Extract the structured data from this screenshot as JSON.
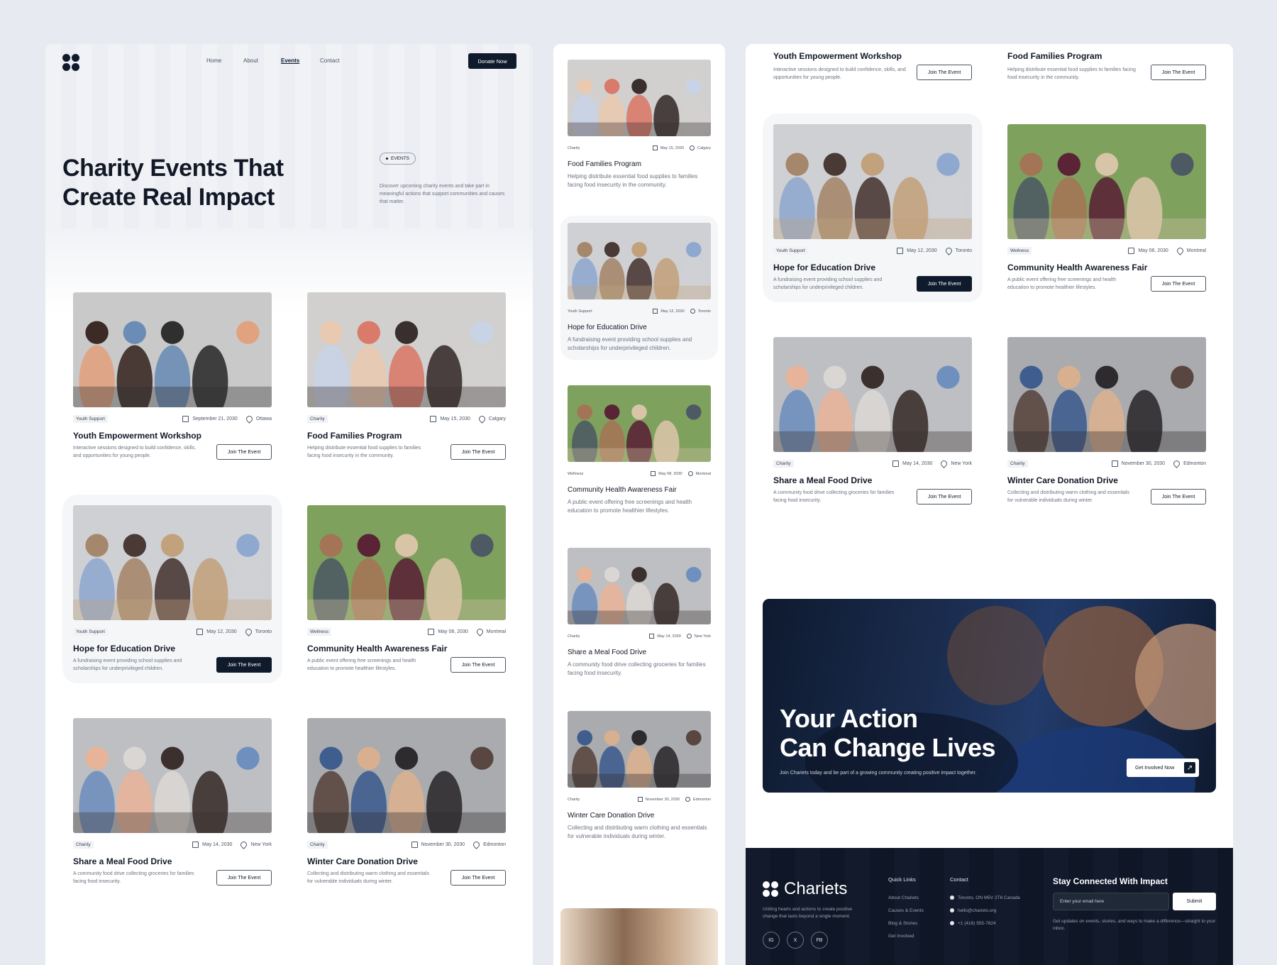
{
  "colors": {
    "navy": "#0f1b2d",
    "bg": "#e7eaf0",
    "text": "#121826",
    "muted": "#6b7280"
  },
  "icons": {
    "logo": "clover-logo-icon",
    "date": "calendar-icon",
    "location": "location-pin-icon",
    "arrow": "arrow-up-right-icon"
  },
  "nav": {
    "items": [
      "Home",
      "About",
      "Events",
      "Contact"
    ],
    "active": "Events",
    "donate": "Donate Now"
  },
  "hero": {
    "title_line1": "Charity Events That",
    "title_line2": "Create Real Impact",
    "badge": "EVENTS",
    "desc": "Discover upcoming charity events and take part in meaningful actions that support communities and causes that matter."
  },
  "events": [
    {
      "tag": "Youth Support",
      "date": "September 21, 2030",
      "location": "Ottawa",
      "title": "Youth Empowerment Workshop",
      "desc": "Interactive sessions designed to build confidence, skills, and opportunities for young people.",
      "button": "Join The Event"
    },
    {
      "tag": "Charity",
      "date": "May 15, 2030",
      "location": "Calgary",
      "title": "Food Families Program",
      "desc": "Helping distribute essential food supplies to families facing food insecurity in the community.",
      "button": "Join The Event"
    },
    {
      "tag": "Youth Support",
      "date": "May 12, 2030",
      "location": "Toronto",
      "title": "Hope for Education Drive",
      "desc": "A fundraising event providing school supplies and scholarships for underprivileged children.",
      "button": "Join The Event"
    },
    {
      "tag": "Wellness",
      "date": "May 08, 2030",
      "location": "Montreal",
      "title": "Community Health Awareness Fair",
      "desc": "A public event offering free screenings and health education to promote healthier lifestyles.",
      "button": "Join The Event"
    },
    {
      "tag": "Charity",
      "date": "May 14, 2030",
      "location": "New York",
      "title": "Share a Meal Food Drive",
      "desc": "A community food drive collecting groceries for families facing food insecurity.",
      "button": "Join The Event"
    },
    {
      "tag": "Charity",
      "date": "November 30, 2030",
      "location": "Edmonton",
      "title": "Winter Care Donation Drive",
      "desc": "Collecting and distributing warm clothing and essentials for vulnerable individuals during winter.",
      "button": "Join The Event"
    }
  ],
  "cta": {
    "line1": "Your Action",
    "line2": "Can Change Lives",
    "sub": "Join Chariets today and be part of a growing community creating positive impact together.",
    "button": "Get Involved Now"
  },
  "footer": {
    "brand": "Chariets",
    "tagline": "Uniting hearts and actions to create positive change that lasts beyond a single moment.",
    "social": [
      "IG",
      "X",
      "FB"
    ],
    "quick_title": "Quick Links",
    "quick": [
      "About Chariets",
      "Causes & Events",
      "Blog & Stories",
      "Get Involved"
    ],
    "contact_title": "Contact",
    "address": "Toronto, ON M5V 2T6 Canada",
    "email": "hello@chariets.org",
    "phone": "+1 (416) 555-7824",
    "newsletter_title": "Stay Connected With Impact",
    "placeholder": "Enter your email here",
    "submit": "Submit",
    "note": "Get updates on events, stories, and ways to make a difference—straight to your inbox."
  }
}
